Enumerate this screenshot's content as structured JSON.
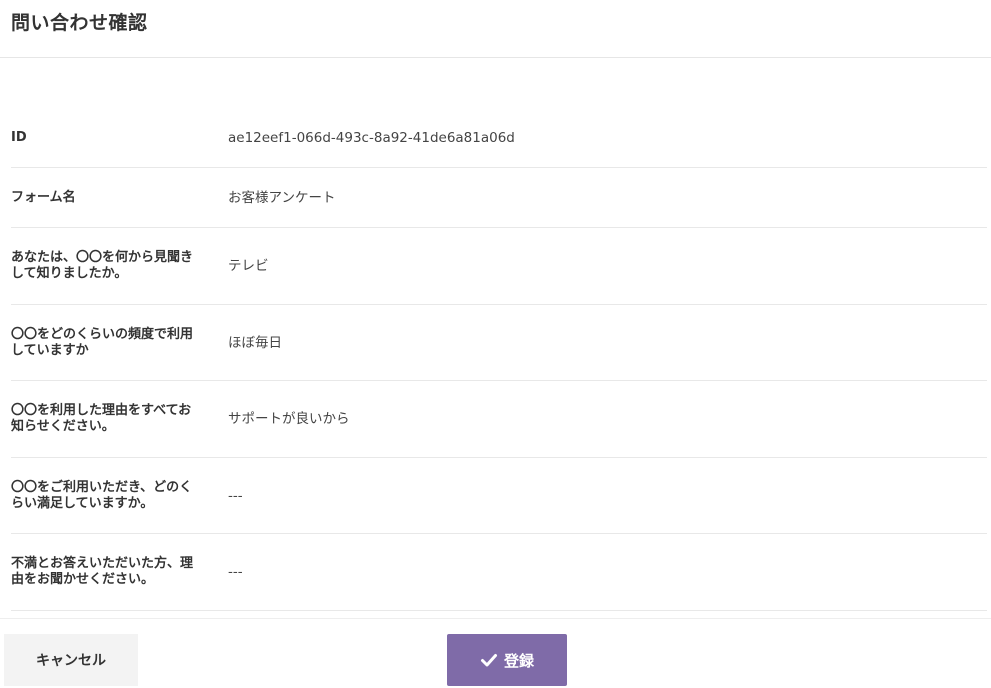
{
  "header": {
    "title": "問い合わせ確認"
  },
  "rows": [
    {
      "label": "ID",
      "value": "ae12eef1-066d-493c-8a92-41de6a81a06d"
    },
    {
      "label": "フォーム名",
      "value": "お客様アンケート"
    },
    {
      "label": "あなたは、〇〇を何から見聞きして知りましたか。",
      "value": "テレビ"
    },
    {
      "label": "〇〇をどのくらいの頻度で利用していますか",
      "value": "ほぼ毎日"
    },
    {
      "label": "〇〇を利用した理由をすべてお知らせください。",
      "value": "サポートが良いから"
    },
    {
      "label": "〇〇をご利用いただき、どのくらい満足していますか。",
      "value": "---"
    },
    {
      "label": "不満とお答えいただいた方、理由をお聞かせください。",
      "value": "---"
    }
  ],
  "footer": {
    "cancel_label": "キャンセル",
    "submit_label": "登録",
    "submit_icon": "check-icon",
    "accent_color": "#7f6ba8"
  }
}
